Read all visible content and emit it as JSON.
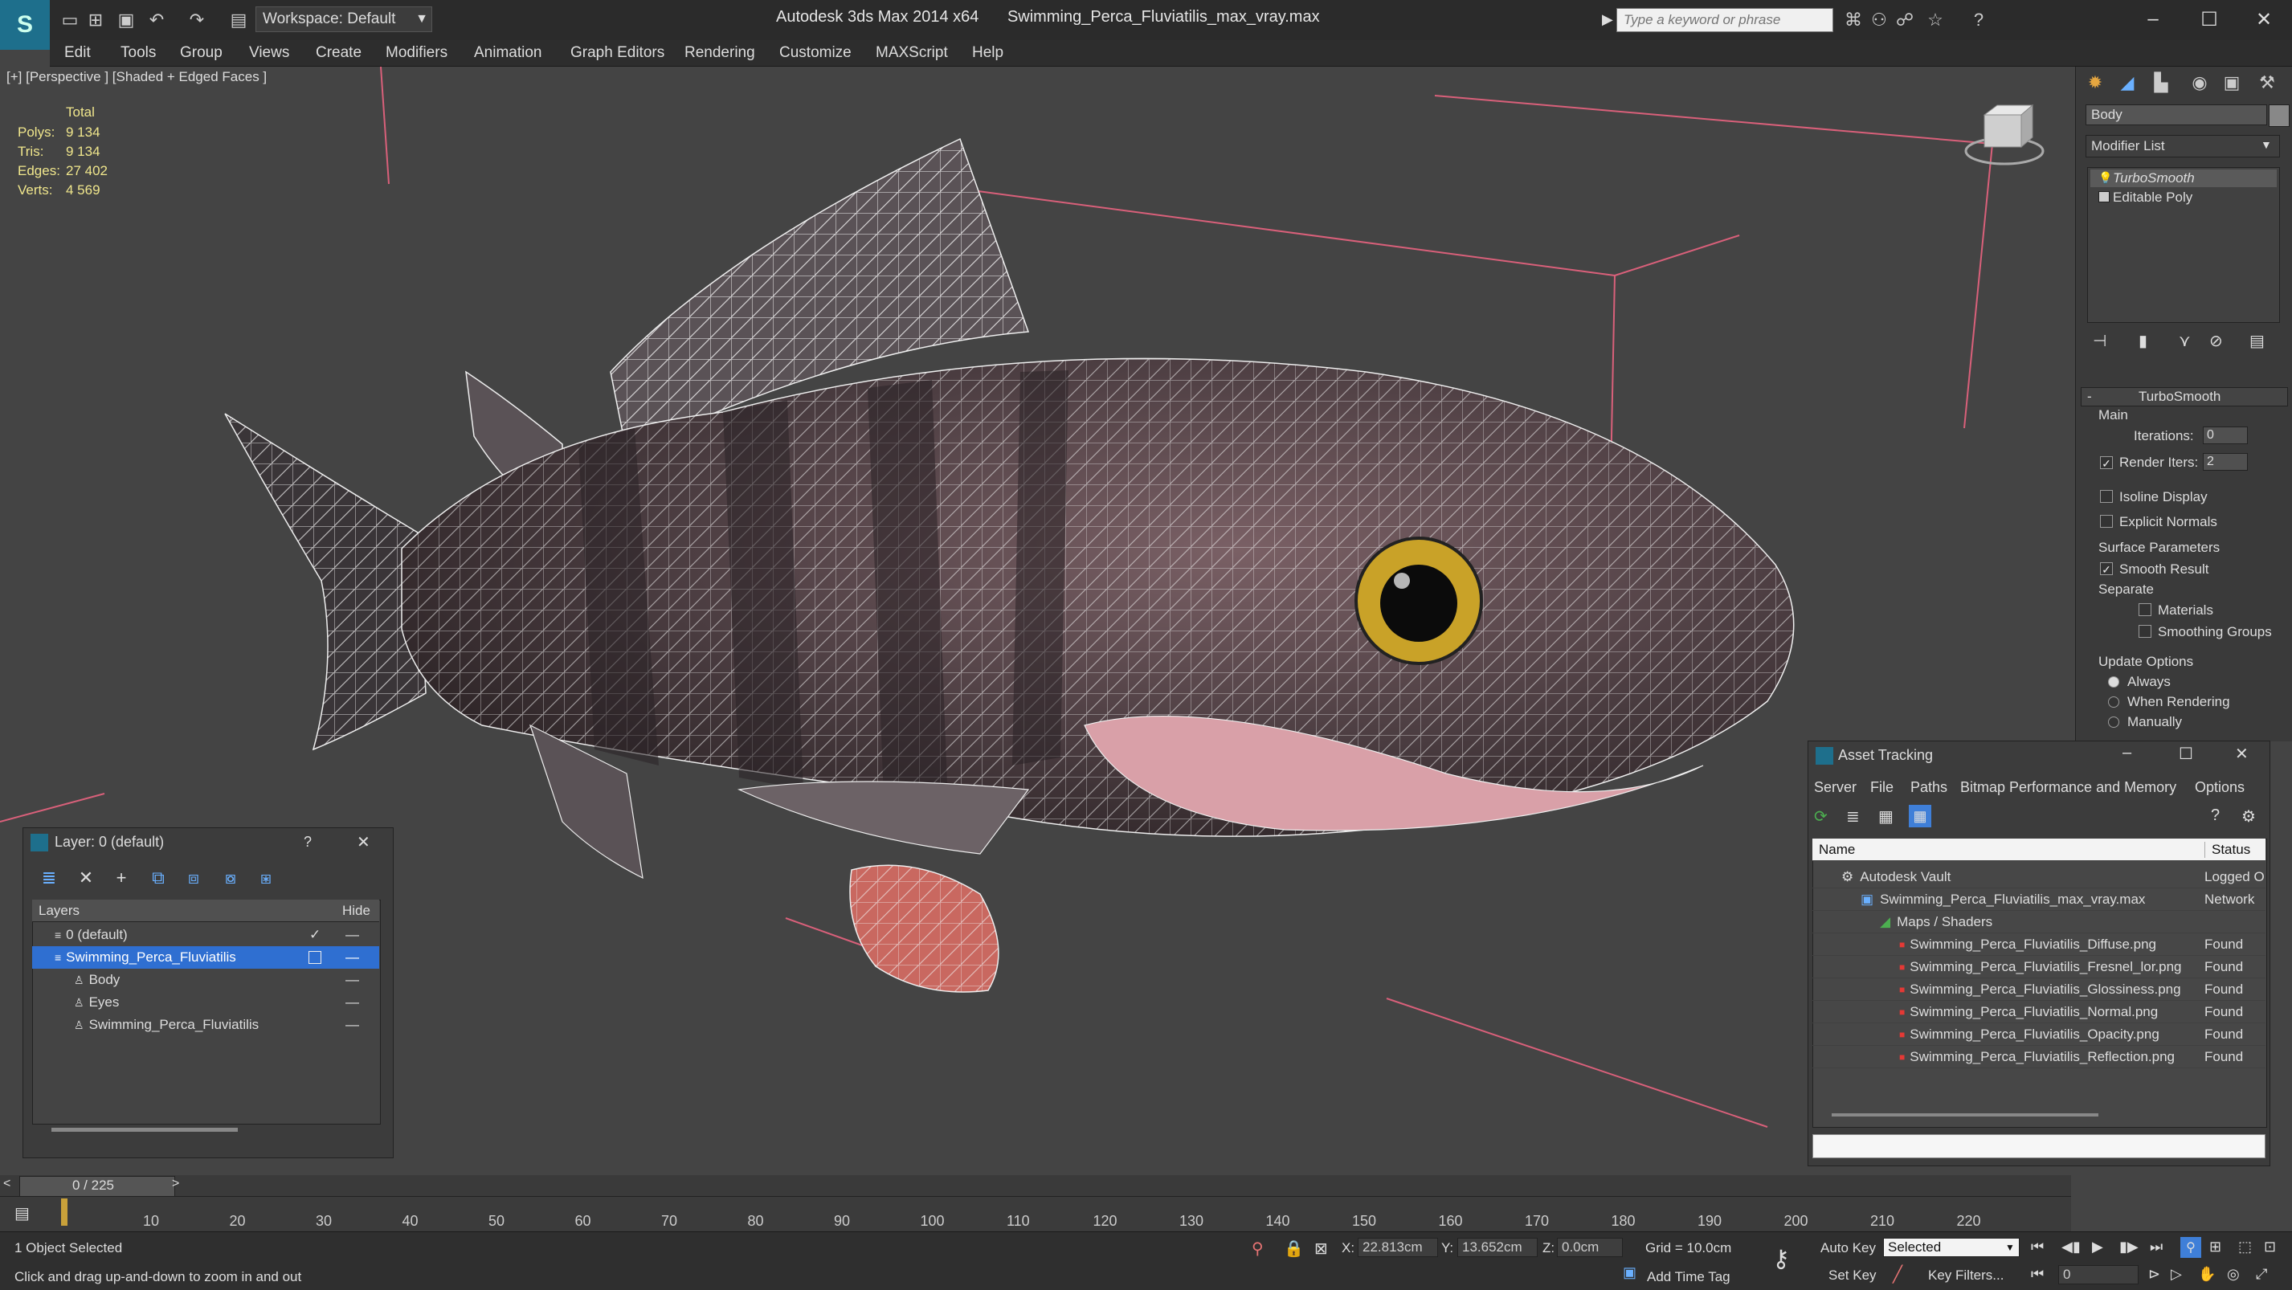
{
  "window": {
    "app_title": "Autodesk 3ds Max  2014 x64",
    "file_title": "Swimming_Perca_Fluviatilis_max_vray.max",
    "workspace": "Workspace: Default",
    "search_placeholder": "Type a keyword or phrase"
  },
  "menu": [
    "Edit",
    "Tools",
    "Group",
    "Views",
    "Create",
    "Modifiers",
    "Animation",
    "Graph Editors",
    "Rendering",
    "Customize",
    "MAXScript",
    "Help"
  ],
  "viewport": {
    "label": "[+] [Perspective ] [Shaded + Edged Faces ]",
    "stats_header": "Total",
    "stats": [
      {
        "label": "Polys:",
        "value": "9 134"
      },
      {
        "label": "Tris:",
        "value": "9 134"
      },
      {
        "label": "Edges:",
        "value": "27 402"
      },
      {
        "label": "Verts:",
        "value": "4 569"
      }
    ]
  },
  "command_panel": {
    "object_name": "Body",
    "modifier_list": "Modifier List",
    "stack": [
      "TurboSmooth",
      "Editable Poly"
    ],
    "rollout_title": "TurboSmooth",
    "main_label": "Main",
    "iterations_label": "Iterations:",
    "iterations_value": "0",
    "render_iters_label": "Render Iters:",
    "render_iters_value": "2",
    "isoline": "Isoline Display",
    "explicit_normals": "Explicit Normals",
    "surface_params": "Surface Parameters",
    "smooth_result": "Smooth Result",
    "separate": "Separate",
    "materials": "Materials",
    "smoothing_groups": "Smoothing Groups",
    "update_options": "Update Options",
    "always": "Always",
    "when_rendering": "When Rendering",
    "manually": "Manually"
  },
  "layer_panel": {
    "title": "Layer: 0 (default)",
    "help": "?",
    "col_layers": "Layers",
    "col_hide": "Hide",
    "rows": [
      "0 (default)",
      "Swimming_Perca_Fluviatilis",
      "Body",
      "Eyes",
      "Swimming_Perca_Fluviatilis"
    ]
  },
  "asset_tracking": {
    "title": "Asset Tracking",
    "menu": [
      "Server",
      "File",
      "Paths",
      "Bitmap Performance and Memory",
      "Options"
    ],
    "col_name": "Name",
    "col_status": "Status",
    "rows": [
      {
        "name": "Autodesk Vault",
        "status": "Logged O"
      },
      {
        "name": "Swimming_Perca_Fluviatilis_max_vray.max",
        "status": "Network"
      },
      {
        "name": "Maps / Shaders",
        "status": ""
      },
      {
        "name": "Swimming_Perca_Fluviatilis_Diffuse.png",
        "status": "Found"
      },
      {
        "name": "Swimming_Perca_Fluviatilis_Fresnel_lor.png",
        "status": "Found"
      },
      {
        "name": "Swimming_Perca_Fluviatilis_Glossiness.png",
        "status": "Found"
      },
      {
        "name": "Swimming_Perca_Fluviatilis_Normal.png",
        "status": "Found"
      },
      {
        "name": "Swimming_Perca_Fluviatilis_Opacity.png",
        "status": "Found"
      },
      {
        "name": "Swimming_Perca_Fluviatilis_Reflection.png",
        "status": "Found"
      }
    ]
  },
  "timeline": {
    "frame_counter": "0 / 225",
    "ticks": [
      "10",
      "20",
      "30",
      "40",
      "50",
      "60",
      "70",
      "80",
      "90",
      "100",
      "110",
      "120",
      "130",
      "140",
      "150",
      "160",
      "170",
      "180",
      "190",
      "200",
      "210",
      "220"
    ]
  },
  "status": {
    "selection": "1 Object Selected",
    "prompt": "Click and drag up-and-down to zoom in and out",
    "x_label": "X:",
    "x_value": "22.813cm",
    "y_label": "Y:",
    "y_value": "13.652cm",
    "z_label": "Z:",
    "z_value": "0.0cm",
    "grid": "Grid = 10.0cm",
    "auto_key": "Auto Key",
    "set_key": "Set Key",
    "selected": "Selected",
    "key_filters": "Key Filters...",
    "add_time_tag": "Add Time Tag",
    "frame": "0"
  }
}
